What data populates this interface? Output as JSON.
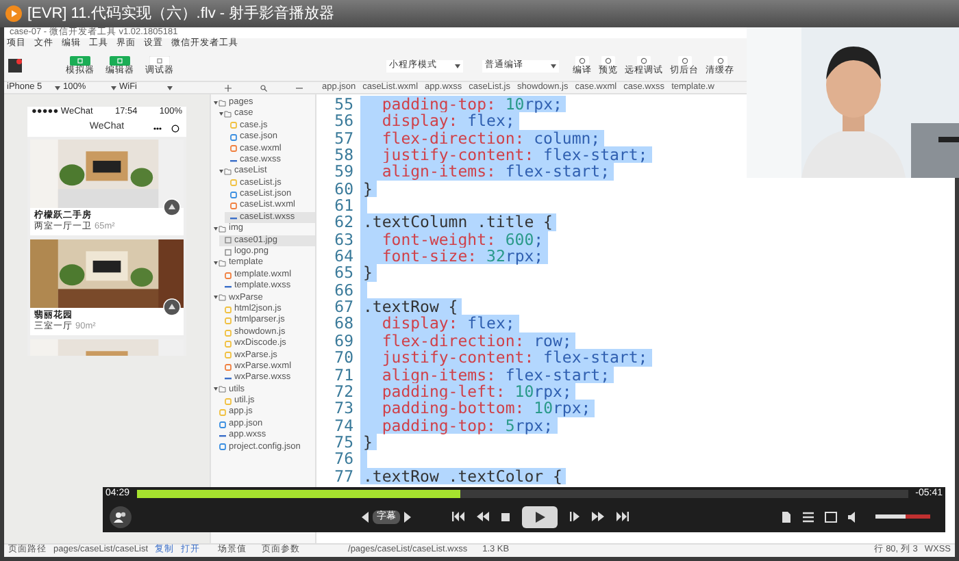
{
  "player": {
    "title": "[EVR] 11.代码实现（六）.flv - 射手影音播放器",
    "time": "04:29",
    "remaining": "-05:41",
    "level": 0.42,
    "subtitle_button": "字幕",
    "volume": {
      "level": 0.55
    }
  },
  "devtools": {
    "title": "case-07 - 微信开发者工具 v1.02.1805181",
    "menu": [
      "项目",
      "文件",
      "编辑",
      "工具",
      "界面",
      "设置",
      "微信开发者工具"
    ],
    "mode_buttons": [
      {
        "label": "模拟器",
        "selected": true
      },
      {
        "label": "编辑器",
        "selected": true
      },
      {
        "label": "调试器",
        "selected": false
      }
    ],
    "mode_select": "小程序模式",
    "compile_select": "普通编译",
    "actions": [
      "编译",
      "预览",
      "远程调试",
      "切后台",
      "清缓存"
    ],
    "sim_toolbar": [
      "iPhone 5",
      "100%",
      "WiFi"
    ],
    "tabs": [
      "app.json",
      "caseList.wxml",
      "app.wxss",
      "caseList.js",
      "showdown.js",
      "case.wxml",
      "case.wxss",
      "template.w"
    ],
    "phone": {
      "status_left": "●●●●● WeChat",
      "time": "17:54",
      "battery": "100%",
      "nav_title": "WeChat",
      "cards": [
        {
          "title": "柠檬跃二手房",
          "detail": "两室一厅一卫",
          "area": "65m²"
        },
        {
          "title": "翡丽花园",
          "detail": "三室一厅",
          "area": "90m²"
        }
      ]
    },
    "tree": [
      {
        "name": "pages",
        "expanded": true,
        "children": [
          {
            "name": "case",
            "expanded": true,
            "children": [
              {
                "name": "case.js",
                "kind": "js",
                "selected": false
              },
              {
                "name": "case.json",
                "kind": "json",
                "selected": false
              },
              {
                "name": "case.wxml",
                "kind": "wxml",
                "selected": false
              },
              {
                "name": "case.wxss",
                "kind": "wxss",
                "selected": false
              }
            ]
          },
          {
            "name": "caseList",
            "expanded": true,
            "children": [
              {
                "name": "caseList.js",
                "kind": "js",
                "selected": false
              },
              {
                "name": "caseList.json",
                "kind": "json",
                "selected": false
              },
              {
                "name": "caseList.wxml",
                "kind": "wxml",
                "selected": false
              },
              {
                "name": "caseList.wxss",
                "kind": "wxss",
                "selected": true
              }
            ]
          }
        ]
      },
      {
        "name": "img",
        "expanded": true,
        "children": [
          {
            "name": "case01.jpg",
            "selected": true
          },
          {
            "name": "logo.png",
            "selected": false
          }
        ]
      },
      {
        "name": "template",
        "expanded": true,
        "children": [
          {
            "name": "template.wxml",
            "kind": "wxml",
            "selected": false
          },
          {
            "name": "template.wxss",
            "kind": "wxss",
            "selected": false
          }
        ]
      },
      {
        "name": "wxParse",
        "expanded": true,
        "children": [
          {
            "name": "html2json.js",
            "kind": "js",
            "selected": false
          },
          {
            "name": "htmlparser.js",
            "kind": "js",
            "selected": false
          },
          {
            "name": "showdown.js",
            "kind": "js",
            "selected": false
          },
          {
            "name": "wxDiscode.js",
            "kind": "js",
            "selected": false
          },
          {
            "name": "wxParse.js",
            "kind": "js",
            "selected": false
          },
          {
            "name": "wxParse.wxml",
            "kind": "wxml",
            "selected": false
          },
          {
            "name": "wxParse.wxss",
            "kind": "wxss",
            "selected": false
          }
        ]
      },
      {
        "name": "utils",
        "expanded": true,
        "children": [
          {
            "name": "util.js",
            "kind": "js",
            "selected": false
          }
        ]
      },
      {
        "name": "app.js",
        "kind": "js",
        "selected": false
      },
      {
        "name": "app.json",
        "kind": "json",
        "selected": false
      },
      {
        "name": "app.wxss",
        "kind": "wxss",
        "selected": false
      },
      {
        "name": "project.config.json",
        "kind": "json",
        "selected": false
      }
    ],
    "code": [
      {
        "number": "55",
        "text": "  padding-top: 10rpx;",
        "selected": true
      },
      {
        "number": "56",
        "text": "  display: flex;",
        "selected": true
      },
      {
        "number": "57",
        "text": "  flex-direction: column;",
        "selected": true
      },
      {
        "number": "58",
        "text": "  justify-content: flex-start;",
        "selected": true
      },
      {
        "number": "59",
        "text": "  align-items: flex-start;",
        "selected": true
      },
      {
        "number": "60",
        "text": "}",
        "selected": true
      },
      {
        "number": "61",
        "selected": true
      },
      {
        "number": "62",
        "text": ".textColumn .title {",
        "selected": true
      },
      {
        "number": "63",
        "text": "  font-weight: 600;",
        "selected": true
      },
      {
        "number": "64",
        "text": "  font-size: 32rpx;",
        "selected": true
      },
      {
        "number": "65",
        "text": "}",
        "selected": true
      },
      {
        "number": "66",
        "selected": true
      },
      {
        "number": "67",
        "text": ".textRow {",
        "selected": true
      },
      {
        "number": "68",
        "text": "  display: flex;",
        "selected": true
      },
      {
        "number": "69",
        "text": "  flex-direction: row;",
        "selected": true
      },
      {
        "number": "70",
        "text": "  justify-content: flex-start;",
        "selected": true
      },
      {
        "number": "71",
        "text": "  align-items: flex-start;",
        "selected": true
      },
      {
        "number": "72",
        "text": "  padding-left: 10rpx;",
        "selected": true
      },
      {
        "number": "73",
        "text": "  padding-bottom: 10rpx;",
        "selected": true
      },
      {
        "number": "74",
        "text": "  padding-top: 5rpx;",
        "selected": true
      },
      {
        "number": "75",
        "text": "}",
        "selected": true
      },
      {
        "number": "76",
        "selected": true
      },
      {
        "number": "77",
        "text": ".textRow .textColor {",
        "selected": true
      }
    ],
    "status": {
      "path_label": "页面路径",
      "path": "pages/caseList/caseList",
      "copy": "复制",
      "open": "打开",
      "scene": "场景值",
      "params": "页面参数",
      "file": "/pages/caseList/caseList.wxss",
      "size": "1.3 KB",
      "position": "行 80, 列 3",
      "lang": "WXSS"
    }
  }
}
